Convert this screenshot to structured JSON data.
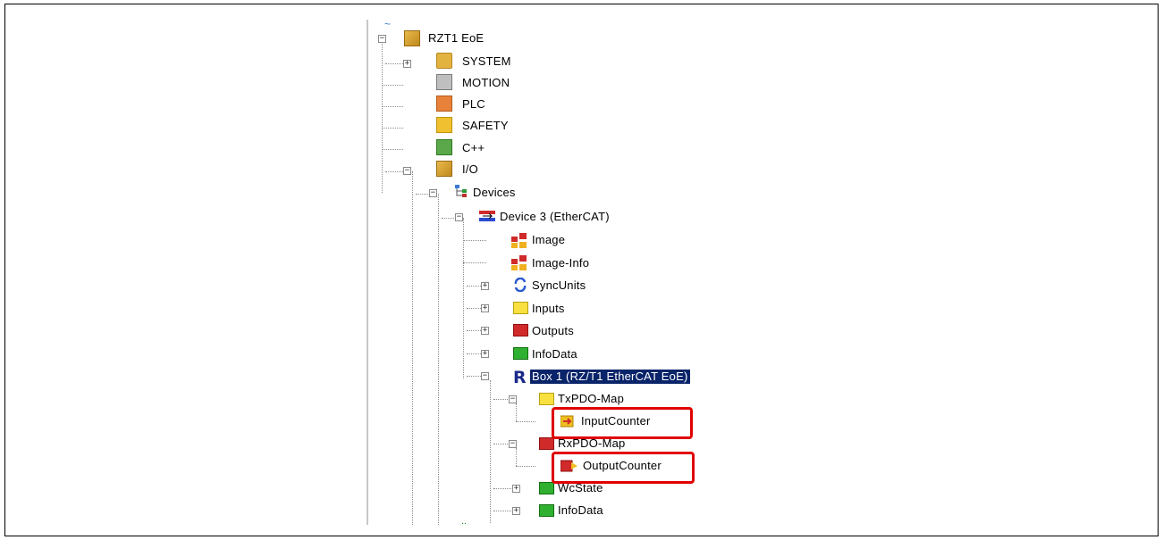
{
  "tree": {
    "root": "RZT1 EoE",
    "system": "SYSTEM",
    "motion": "MOTION",
    "plc": "PLC",
    "safety": "SAFETY",
    "cpp": "C++",
    "io": "I/O",
    "devices": "Devices",
    "device3": "Device 3 (EtherCAT)",
    "image": "Image",
    "image_info": "Image-Info",
    "syncunits": "SyncUnits",
    "inputs": "Inputs",
    "outputs": "Outputs",
    "infodata": "InfoData",
    "box1": "Box 1 (RZ/T1 EtherCAT EoE)",
    "txpdo": "TxPDO-Map",
    "inputcounter": "InputCounter",
    "rxpdo": "RxPDO-Map",
    "outputcounter": "OutputCounter",
    "wcstate": "WcState",
    "infodata2": "InfoData"
  },
  "expander_symbols": {
    "expanded": "−",
    "collapsed": "+"
  },
  "colors": {
    "highlight": "#e00000",
    "selection_bg": "#0a246a",
    "tree_line": "#8a8a8a"
  }
}
